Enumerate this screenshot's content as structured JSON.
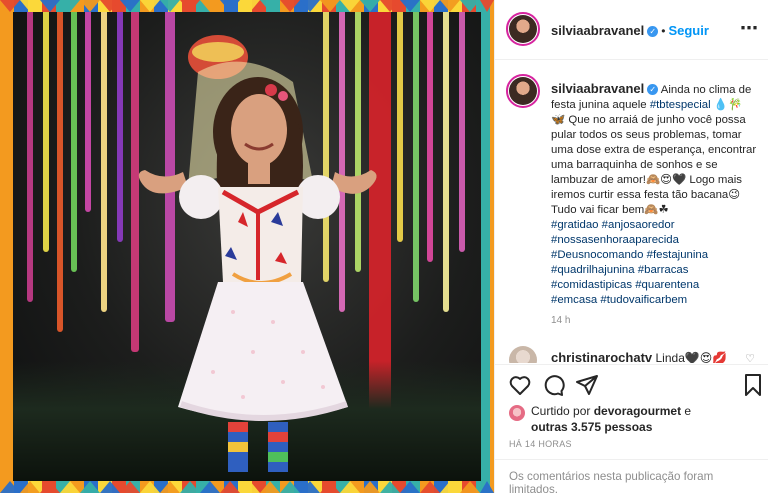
{
  "post": {
    "username": "silviaabravanel",
    "verified_icon": "verified-badge-icon",
    "follow_label": "Seguir",
    "caption_text": "Ainda no clima de festa junina aquele",
    "caption_tag1": "#tbtespecial",
    "caption_body": " 💧🎋 🦋 Que no arraiá de junho você possa pular todos os seus problemas, tomar uma dose extra de esperança, encontrar uma barraquinha de sonhos e se lambuzar de amor!🙈😍🖤 Logo mais iremos curtir essa festa tão bacana😉 Tudo vai ficar bem🙈☘",
    "hashtags": [
      "#gratidao",
      "#anjosaoredor",
      "#nossasenhoraaparecida",
      "#Deusnocomando",
      "#festajunina",
      "#quadrilhajunina",
      "#barracas",
      "#comidastipicas",
      "#quarentena",
      "#emcasa",
      "#tudovaificarbem"
    ],
    "caption_time": "14 h",
    "comment": {
      "username": "christinarochatv",
      "text": "Linda🖤😍💋"
    },
    "liked_prefix": "Curtido por",
    "liked_user": "devoragourmet",
    "liked_mid": "e",
    "liked_count": "outras 3.575 pessoas",
    "post_time": "HÁ 14 HORAS",
    "limited_text": "Os comentários nesta publicação foram limitados."
  },
  "colors": {
    "link": "#00376b",
    "follow": "#0095f6",
    "muted": "#8e8e8e"
  }
}
